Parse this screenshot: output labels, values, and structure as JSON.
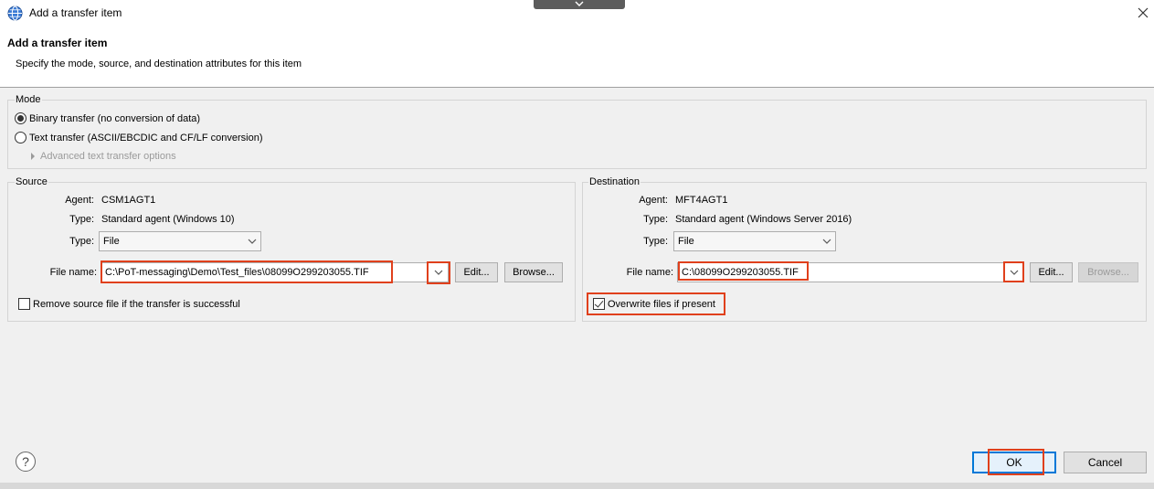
{
  "window": {
    "title": "Add a transfer item"
  },
  "header": {
    "title": "Add a transfer item",
    "description": "Specify the mode, source, and destination attributes for this item"
  },
  "mode": {
    "label": "Mode",
    "binary_label": "Binary transfer (no conversion of data)",
    "text_label": "Text transfer (ASCII/EBCDIC and CF/LF conversion)",
    "advanced_label": "Advanced text transfer options",
    "selected": "binary"
  },
  "source": {
    "label": "Source",
    "agent_label": "Agent:",
    "agent_value": "CSM1AGT1",
    "type_label": "Type:",
    "type_value": "Standard agent (Windows 10)",
    "type_select_label": "Type:",
    "type_select_value": "File",
    "file_name_label": "File name:",
    "file_name_value": "C:\\PoT-messaging\\Demo\\Test_files\\08099O299203055.TIF",
    "edit_label": "Edit...",
    "browse_label": "Browse...",
    "remove_label": "Remove source file if the transfer is successful",
    "remove_checked": false
  },
  "destination": {
    "label": "Destination",
    "agent_label": "Agent:",
    "agent_value": "MFT4AGT1",
    "type_label": "Type:",
    "type_value": "Standard agent (Windows Server 2016)",
    "type_select_label": "Type:",
    "type_select_value": "File",
    "file_name_label": "File name:",
    "file_name_value": "C:\\08099O299203055.TIF",
    "edit_label": "Edit...",
    "browse_label": "Browse...",
    "overwrite_label": "Overwrite files if present",
    "overwrite_checked": true
  },
  "footer": {
    "help_label": "?",
    "ok_label": "OK",
    "cancel_label": "Cancel"
  },
  "colors": {
    "highlight": "#e0401c",
    "focus": "#0078d7",
    "background": "#f0f0f0"
  },
  "icons": {
    "window": "globe-icon",
    "close": "close-icon",
    "dropdown": "chevron-down-icon",
    "help": "help-icon"
  }
}
